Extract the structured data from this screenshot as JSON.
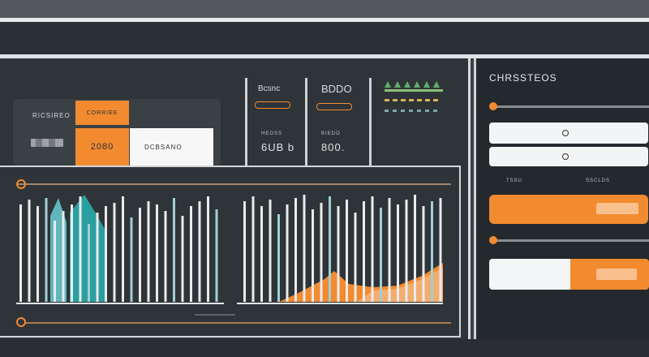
{
  "colors": {
    "accent": "#f28b30",
    "teal": "#2fa7a8",
    "panel": "#2f3438",
    "light": "#f3f4f5"
  },
  "kpi_card": {
    "label": "RICSIREO",
    "tab_label": "CORRIEE",
    "orange_value": "2080",
    "field_text": "DCBSANO"
  },
  "stats": [
    {
      "title": "Bcsnc",
      "small": "HEOSS",
      "value": "6UB b"
    },
    {
      "title": "BDDO",
      "small": "BIEDO",
      "value": "800."
    },
    {
      "title": "",
      "small": "",
      "value": ""
    }
  ],
  "side_panel": {
    "title": "CHRSSTEOS",
    "caption_left": "TSSU",
    "caption_right": "SSCLDS"
  },
  "icons": [
    "radio-icon",
    "slider-knob-icon",
    "legend-circle-icon"
  ]
}
